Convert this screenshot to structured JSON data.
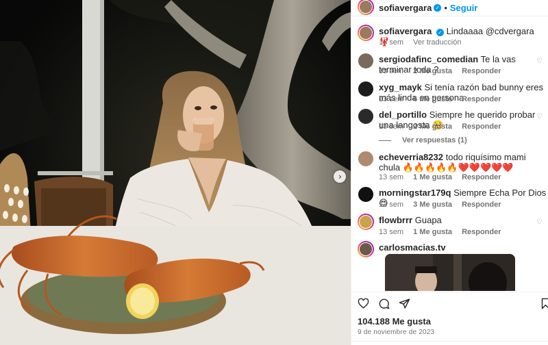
{
  "header": {
    "username": "sofiavergara",
    "separator": "•",
    "follow_label": "Seguir",
    "more_label": "···",
    "verified_glyph": "✓"
  },
  "caption": {
    "username": "sofiavergara",
    "text": "Lindaaaa @cdvergara 🦞",
    "time": "13 sem",
    "translate_label": "Ver traducción"
  },
  "comments": [
    {
      "username": "sergiodafinc_comedian",
      "text": "Te la vas terminar toda ?",
      "time": "13 sem",
      "likes": "2 Me gusta",
      "reply": "Responder",
      "avatar_color": "#7a6a5c"
    },
    {
      "username": "xyg_mayk",
      "text": "Si tenía razón bad bunny eres más linda en persona",
      "time": "13 sem",
      "likes": "6 Me gusta",
      "reply": "Responder",
      "avatar_color": "#1c1c1c"
    },
    {
      "username": "del_portillo",
      "text": "Siempre he querido probar una langosta 🥺",
      "time": "13 sem",
      "likes": "2 Me gusta",
      "reply": "Responder",
      "replies": "Ver respuestas (1)",
      "avatar_color": "#2a2a2a"
    },
    {
      "username": "echeverria8232",
      "text": "todo riquísimo mami chula 🔥🔥🔥🔥🔥❤️❤️❤️❤️❤️",
      "time": "13 sem",
      "likes": "1 Me gusta",
      "reply": "Responder",
      "avatar_color": "#b08a6e"
    },
    {
      "username": "morningstar179q",
      "text": "Siempre Echa Por Dios 😍",
      "time": "13 sem",
      "likes": "3 Me gusta",
      "reply": "Responder",
      "avatar_color": "#111111"
    },
    {
      "username": "flowbrrr",
      "text": "Guapa",
      "time": "13 sem",
      "likes": "1 Me gusta",
      "reply": "Responder",
      "avatar_color": "#c9a34a"
    },
    {
      "username": "carlosmacias.tv",
      "text": "",
      "avatar_color": "#6b5a4a"
    }
  ],
  "actions": {
    "likes": "104.188 Me gusta",
    "date": "9 de noviembre de 2023",
    "icons": [
      "heart-icon",
      "comment-icon",
      "share-icon",
      "bookmark-icon"
    ]
  },
  "media": {
    "next_glyph": "›",
    "description_colors": {
      "background": "#101110",
      "tree": "#8f8a7e",
      "lobster": "#c8642a",
      "dress": "#eeeae4"
    }
  },
  "colors": {
    "accent": "#0095f6",
    "text": "#262626",
    "secondary": "#737373",
    "border": "#efefef"
  }
}
